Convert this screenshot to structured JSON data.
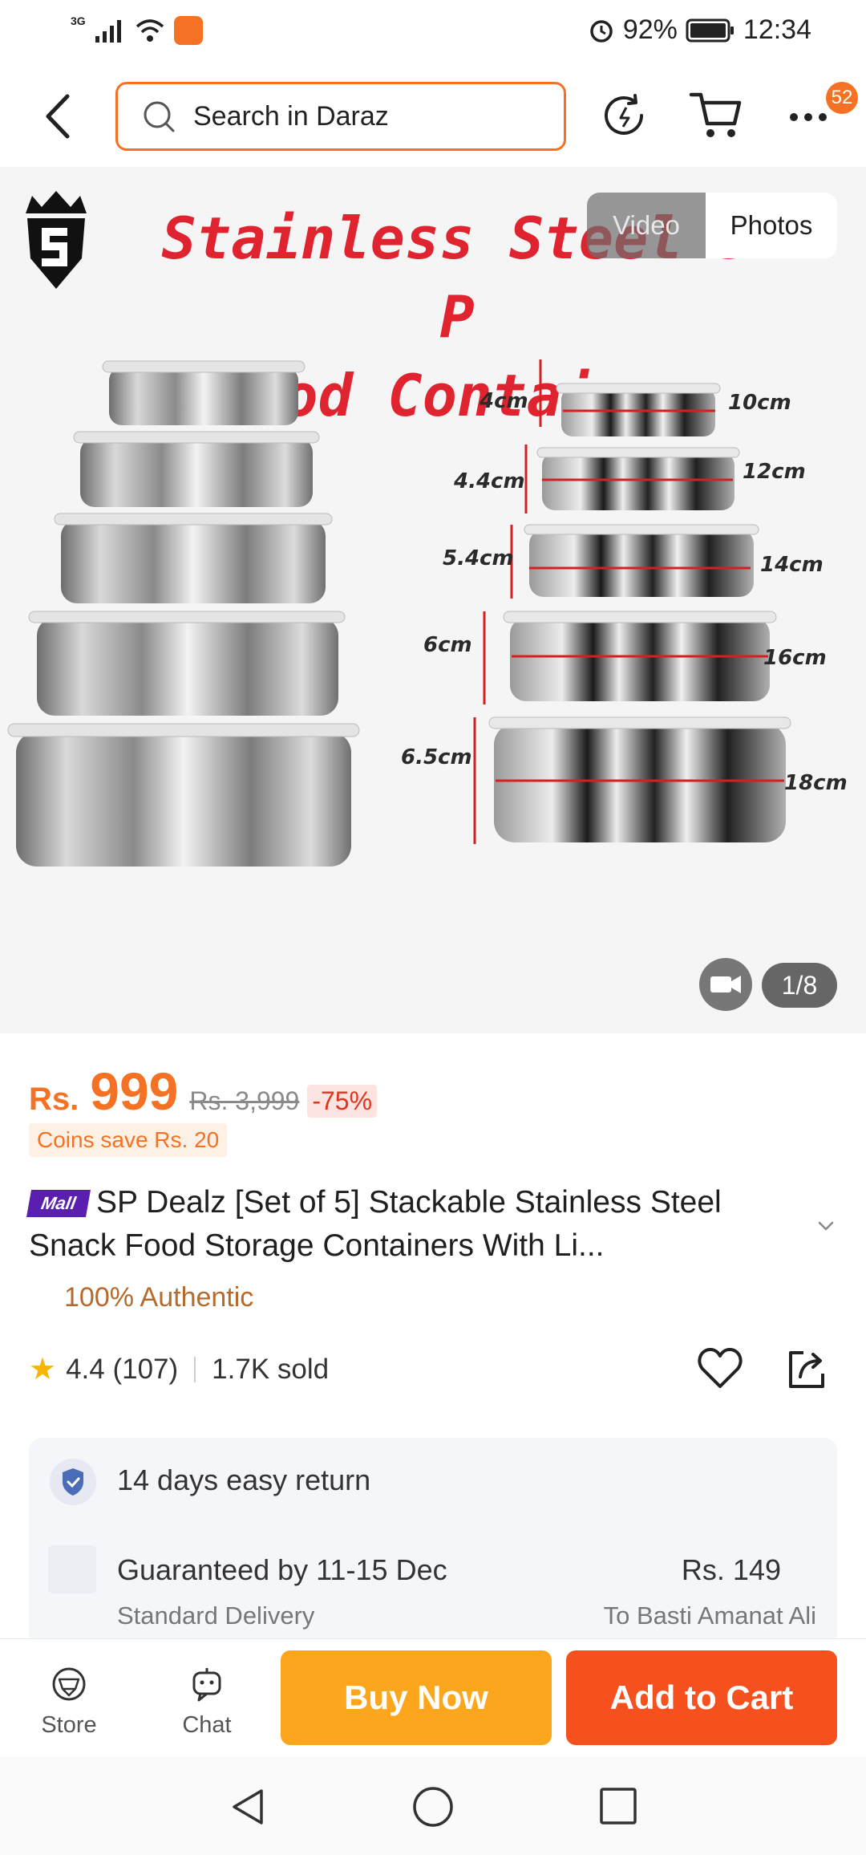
{
  "status_bar": {
    "network": "3G",
    "battery": "92%",
    "time": "12:34"
  },
  "header": {
    "search_placeholder": "Search in Daraz",
    "cart_badge": "52"
  },
  "gallery": {
    "banner_line1": "Stainless Steel 5 P",
    "banner_line2": "Food Container",
    "toggle_video": "Video",
    "toggle_photos": "Photos",
    "counter": "1/8",
    "heights": [
      "4cm",
      "4.4cm",
      "5.4cm",
      "6cm",
      "6.5cm"
    ],
    "diameters": [
      "10cm",
      "12cm",
      "14cm",
      "16cm",
      "18cm"
    ]
  },
  "product": {
    "currency": "Rs.",
    "price": "999",
    "old_price": "Rs. 3,999",
    "discount": "-75%",
    "coins": "Coins save Rs. 20",
    "mall_tag": "Mall",
    "title": "SP Dealz [Set of 5] Stackable Stainless Steel Snack Food Storage Containers With Li...",
    "authentic": "100% Authentic",
    "rating": "4.4 (107)",
    "sold": "1.7K sold"
  },
  "service": {
    "return": "14 days easy return",
    "guarantee": "Guaranteed by 11-15 Dec",
    "shipping_price": "Rs. 149",
    "delivery_type": "Standard Delivery",
    "to_location": "To Basti Amanat Ali"
  },
  "actions": {
    "store": "Store",
    "chat": "Chat",
    "buy_now": "Buy Now",
    "add_to_cart": "Add to Cart"
  },
  "colors": {
    "accent": "#f57224",
    "buy_now": "#fca61d",
    "add_to_cart": "#f5501e",
    "mall": "#5a1fae"
  }
}
